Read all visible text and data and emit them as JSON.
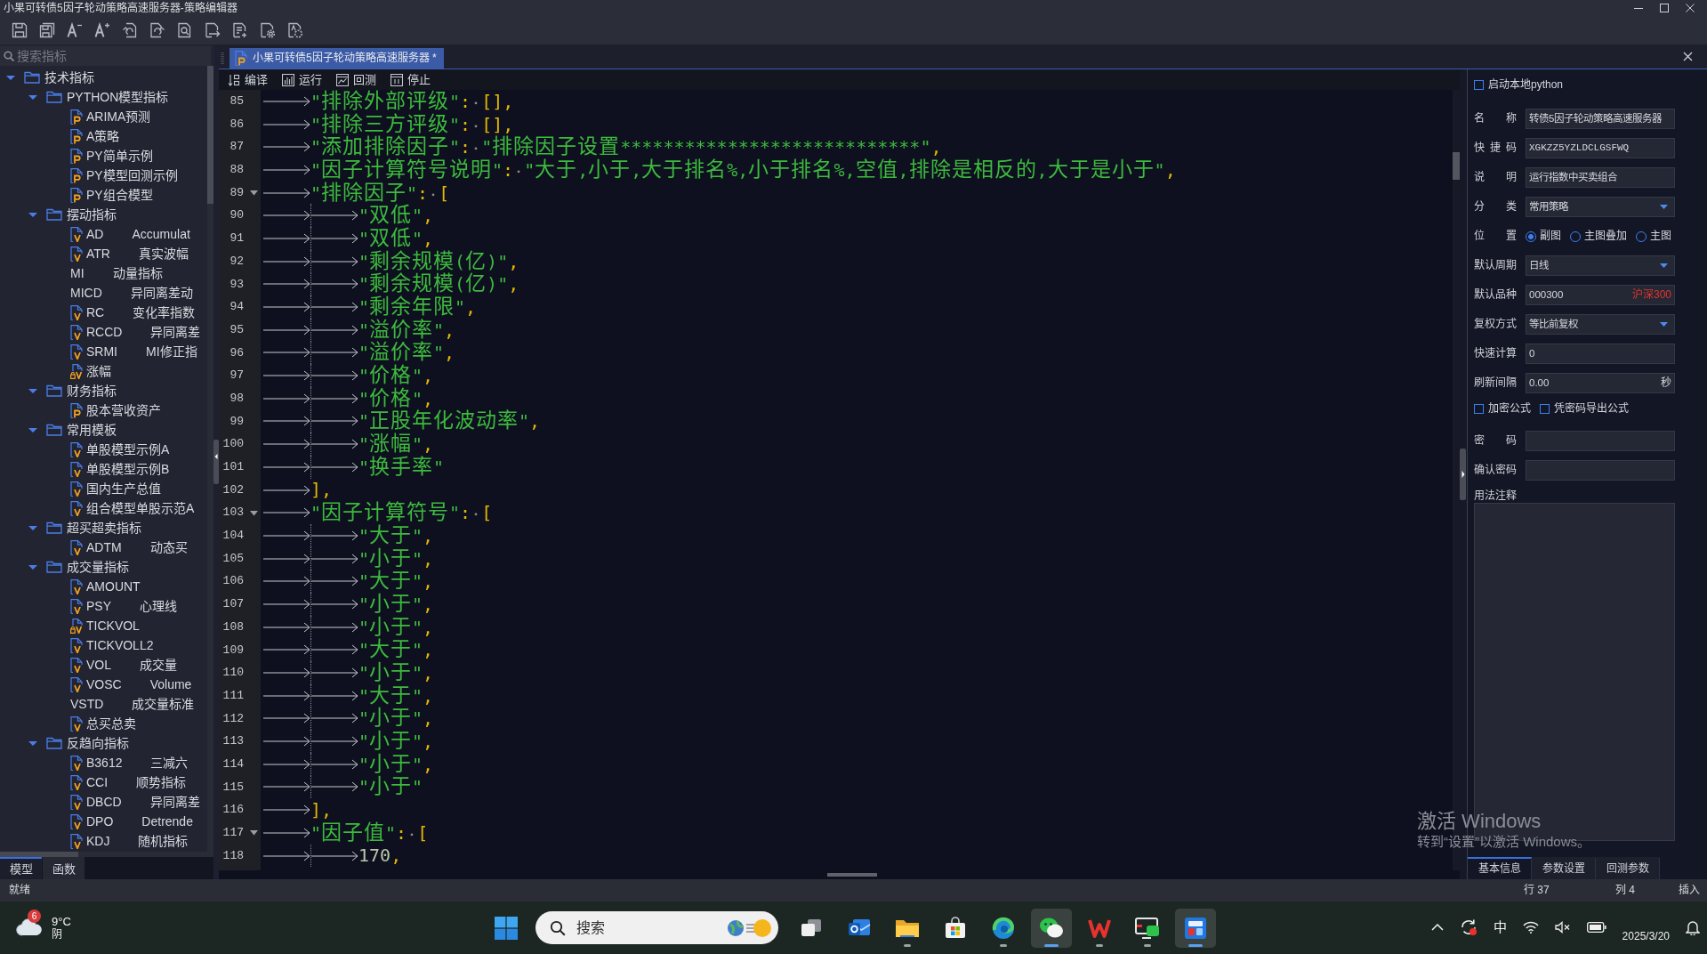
{
  "window": {
    "title": "小果可转债5因子轮动策略高速服务器-策略编辑器"
  },
  "sidebar": {
    "search": {
      "placeholder": "搜索指标"
    },
    "tree": [
      {
        "label": "技术指标",
        "expanded": true,
        "children": [
          {
            "label": "PYTHON模型指标",
            "expanded": true,
            "children": [
              {
                "kind": "python",
                "label": "ARIMA预测"
              },
              {
                "kind": "python",
                "label": "A策略"
              },
              {
                "kind": "python",
                "label": "PY简单示例"
              },
              {
                "kind": "python",
                "label": "PY模型回测示例"
              },
              {
                "kind": "python",
                "label": "PY组合模型"
              }
            ]
          },
          {
            "label": "摆动指标",
            "expanded": true,
            "children": [
              {
                "kind": "formula",
                "label": "AD",
                "description": "Accumulat"
              },
              {
                "kind": "formula",
                "label": "ATR",
                "description": "真实波幅"
              },
              {
                "kind": "plain",
                "label": "MI",
                "description": "动量指标"
              },
              {
                "kind": "plain",
                "label": "MICD",
                "description": "异同离差动"
              },
              {
                "kind": "formula",
                "label": "RC",
                "description": "变化率指数"
              },
              {
                "kind": "formula",
                "label": "RCCD",
                "description": "异同离差"
              },
              {
                "kind": "formula",
                "label": "SRMI",
                "description": "MI修正指"
              },
              {
                "kind": "locked",
                "label": "涨幅"
              }
            ]
          },
          {
            "label": "财务指标",
            "expanded": true,
            "children": [
              {
                "kind": "python",
                "label": "股本营收资产"
              }
            ]
          },
          {
            "label": "常用模板",
            "expanded": true,
            "children": [
              {
                "kind": "formula",
                "label": "单股模型示例A"
              },
              {
                "kind": "formula",
                "label": "单股模型示例B"
              },
              {
                "kind": "formula",
                "label": "国内生产总值"
              },
              {
                "kind": "formula",
                "label": "组合模型单股示范A"
              }
            ]
          },
          {
            "label": "超买超卖指标",
            "expanded": true,
            "children": [
              {
                "kind": "formula",
                "label": "ADTM",
                "description": "动态买"
              }
            ]
          },
          {
            "label": "成交量指标",
            "expanded": true,
            "children": [
              {
                "kind": "formula",
                "label": "AMOUNT"
              },
              {
                "kind": "formula",
                "label": "PSY",
                "description": "心理线"
              },
              {
                "kind": "locked",
                "label": "TICKVOL"
              },
              {
                "kind": "formula",
                "label": "TICKVOLL2"
              },
              {
                "kind": "formula",
                "label": "VOL",
                "description": "成交量"
              },
              {
                "kind": "formula",
                "label": "VOSC",
                "description": "Volume"
              },
              {
                "kind": "plain",
                "label": "VSTD",
                "description": "成交量标准"
              },
              {
                "kind": "formula",
                "label": "总买总卖"
              }
            ]
          },
          {
            "label": "反趋向指标",
            "expanded": true,
            "children": [
              {
                "kind": "formula",
                "label": "B3612",
                "description": "三减六"
              },
              {
                "kind": "formula",
                "label": "CCI",
                "description": "顺势指标"
              },
              {
                "kind": "formula",
                "label": "DBCD",
                "description": "异同离差"
              },
              {
                "kind": "formula",
                "label": "DPO",
                "description": "Detrende"
              },
              {
                "kind": "formula",
                "label": "KDJ",
                "description": "随机指标"
              }
            ]
          }
        ]
      }
    ],
    "tabs": [
      {
        "label": "模型",
        "selected": true
      },
      {
        "label": "函数",
        "selected": false
      }
    ]
  },
  "editor": {
    "tabs": [
      {
        "label": "小果可转债5因子轮动策略高速服务器 *",
        "selected": true
      }
    ],
    "actions": [
      {
        "kind": "compile",
        "label": "编译"
      },
      {
        "kind": "run",
        "label": "运行"
      },
      {
        "kind": "backtest",
        "label": "回测"
      },
      {
        "kind": "stop",
        "label": "停止"
      }
    ],
    "lines": [
      {
        "number": "85",
        "code": "\"排除外部评级\": [],"
      },
      {
        "number": "86",
        "code": "\"排除三方评级\": [],"
      },
      {
        "number": "87",
        "code": "\"添加排除因子\": \"排除因子设置****************************\","
      },
      {
        "number": "88",
        "code": "\"因子计算符号说明\": \"大于,小于,大于排名%,小于排名%,空值,排除是相反的,大于是小于\","
      },
      {
        "number": "89",
        "code": "\"排除因子\": [",
        "expanded": true,
        "children": [
          {
            "number": "90",
            "code": "\"双低\","
          },
          {
            "number": "91",
            "code": "\"双低\","
          },
          {
            "number": "92",
            "code": "\"剩余规模(亿)\","
          },
          {
            "number": "93",
            "code": "\"剩余规模(亿)\","
          },
          {
            "number": "94",
            "code": "\"剩余年限\","
          },
          {
            "number": "95",
            "code": "\"溢价率\","
          },
          {
            "number": "96",
            "code": "\"溢价率\","
          },
          {
            "number": "97",
            "code": "\"价格\","
          },
          {
            "number": "98",
            "code": "\"价格\","
          },
          {
            "number": "99",
            "code": "\"正股年化波动率\","
          },
          {
            "number": "100",
            "code": "\"涨幅\","
          },
          {
            "number": "101",
            "code": "\"换手率\""
          }
        ]
      },
      {
        "number": "102",
        "code": "],"
      },
      {
        "number": "103",
        "code": "\"因子计算符号\": [",
        "expanded": true,
        "children": [
          {
            "number": "104",
            "code": "\"大于\","
          },
          {
            "number": "105",
            "code": "\"小于\","
          },
          {
            "number": "106",
            "code": "\"大于\","
          },
          {
            "number": "107",
            "code": "\"小于\","
          },
          {
            "number": "108",
            "code": "\"小于\","
          },
          {
            "number": "109",
            "code": "\"大于\","
          },
          {
            "number": "110",
            "code": "\"小于\","
          },
          {
            "number": "111",
            "code": "\"大于\","
          },
          {
            "number": "112",
            "code": "\"小于\","
          },
          {
            "number": "113",
            "code": "\"小于\","
          },
          {
            "number": "114",
            "code": "\"小于\","
          },
          {
            "number": "115",
            "code": "\"小于\""
          }
        ]
      },
      {
        "number": "116",
        "code": "],"
      },
      {
        "number": "117",
        "code": "\"因子值\": [",
        "expanded": true,
        "children": [
          {
            "number": "118",
            "code": "170,"
          }
        ]
      }
    ]
  },
  "properties": {
    "run_local_python": {
      "label": "启动本地python",
      "checked": false
    },
    "fields": [
      {
        "kind": "text",
        "label": "名称",
        "value": "转债5因子轮动策略高速服务器"
      },
      {
        "kind": "text",
        "label": "快捷码",
        "value": "XGKZZ5YZLDCLGSFWQ"
      },
      {
        "kind": "text",
        "label": "说明",
        "value": "运行指数中买卖组合"
      },
      {
        "kind": "select",
        "label": "分类",
        "value": "常用策略"
      },
      {
        "kind": "radio",
        "label": "位置",
        "options": [
          {
            "label": "副图",
            "selected": true
          },
          {
            "label": "主图叠加",
            "selected": false
          },
          {
            "label": "主图",
            "selected": false
          }
        ]
      },
      {
        "kind": "select",
        "label": "默认周期",
        "value": "日线"
      },
      {
        "kind": "symbol",
        "label": "默认品种",
        "value": "000300",
        "note": "沪深300"
      },
      {
        "kind": "select",
        "label": "复权方式",
        "value": "等比前复权"
      },
      {
        "kind": "text",
        "label": "快速计算",
        "value": "0"
      },
      {
        "kind": "unit",
        "label": "刷新间隔",
        "value": "0.00",
        "unit": "秒"
      },
      {
        "kind": "checks",
        "options": [
          {
            "label": "加密公式",
            "checked": false
          },
          {
            "label": "凭密码导出公式",
            "checked": false
          }
        ]
      },
      {
        "kind": "password",
        "label": "密码"
      },
      {
        "kind": "password",
        "label": "确认密码"
      },
      {
        "kind": "textarea",
        "label": "用法注释"
      }
    ],
    "tabs": [
      {
        "label": "基本信息",
        "selected": true
      },
      {
        "label": "参数设置",
        "selected": false
      },
      {
        "label": "回测参数",
        "selected": false
      }
    ]
  },
  "status_bar": {
    "message": "就绪",
    "line": "行 37",
    "column": "列 4",
    "mode": "插入"
  },
  "activation_notice": {
    "title": "激活 Windows",
    "hint": "转到“设置”以激活 Windows。"
  },
  "taskbar": {
    "weather": {
      "badge": "6",
      "temperature": "9°C",
      "condition": "阴"
    },
    "search": {
      "placeholder": "搜索"
    },
    "apps": [
      {
        "kind": "task_view",
        "running": false,
        "active": false
      },
      {
        "kind": "mail",
        "running": false,
        "active": false
      },
      {
        "kind": "files",
        "running": true,
        "active": false
      },
      {
        "kind": "store",
        "running": false,
        "active": false
      },
      {
        "kind": "browser",
        "running": true,
        "active": false
      },
      {
        "kind": "chat",
        "running": true,
        "active": true
      },
      {
        "kind": "office",
        "running": true,
        "active": false
      },
      {
        "kind": "screen",
        "running": true,
        "active": false
      },
      {
        "kind": "trading",
        "running": true,
        "active": true
      }
    ],
    "tray": {
      "input_method": "中",
      "date": "2025/3/20"
    }
  }
}
